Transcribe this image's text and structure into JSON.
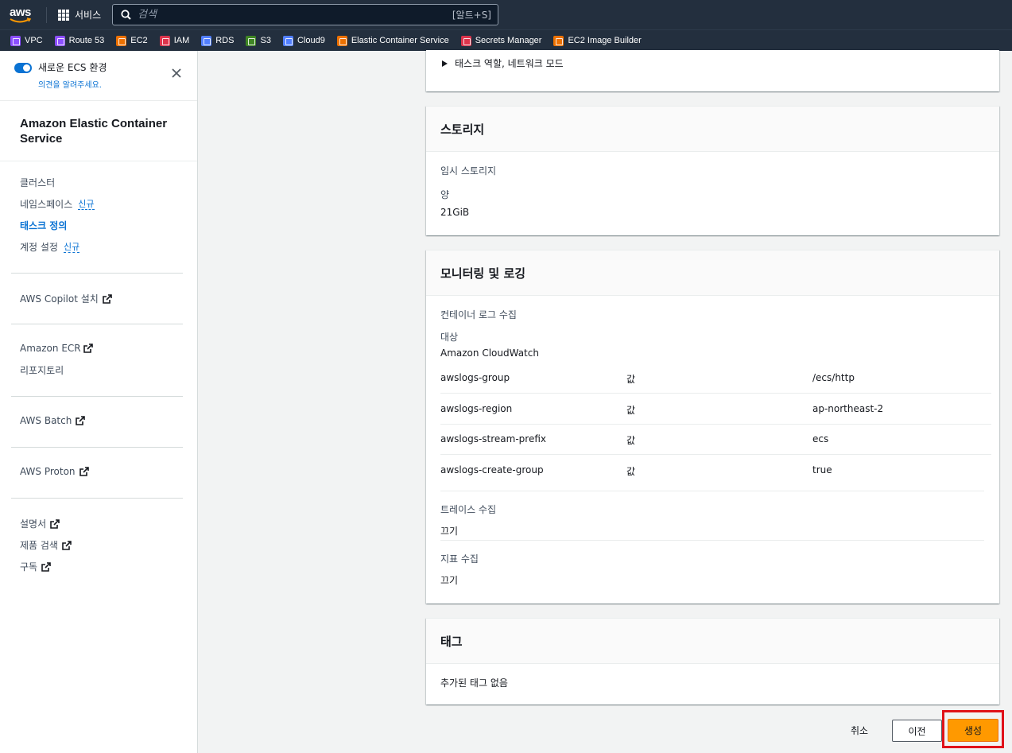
{
  "topnav": {
    "logo": "aws",
    "services_label": "서비스",
    "search_placeholder": "검색",
    "search_shortcut": "[알트+S]"
  },
  "favorites": [
    {
      "label": "VPC",
      "color": "#8c4fff"
    },
    {
      "label": "Route 53",
      "color": "#8c4fff"
    },
    {
      "label": "EC2",
      "color": "#ed7100"
    },
    {
      "label": "IAM",
      "color": "#dd344c"
    },
    {
      "label": "RDS",
      "color": "#527fff"
    },
    {
      "label": "S3",
      "color": "#3f8624"
    },
    {
      "label": "Cloud9",
      "color": "#527fff"
    },
    {
      "label": "Elastic Container Service",
      "color": "#ed7100"
    },
    {
      "label": "Secrets Manager",
      "color": "#dd344c"
    },
    {
      "label": "EC2 Image Builder",
      "color": "#ed7100"
    }
  ],
  "sidebar": {
    "toggle_title": "새로운 ECS 환경",
    "toggle_link": "의견을 알려주세요.",
    "service_title": "Amazon Elastic Container Service",
    "nav": {
      "clusters": "클러스터",
      "namespaces": "네임스페이스",
      "namespaces_badge": "신규",
      "task_definitions": "태스크 정의",
      "account_settings": "계정 설정",
      "account_badge": "신규",
      "copilot": "AWS Copilot 설치",
      "ecr": "Amazon ECR",
      "repositories": "리포지토리",
      "batch": "AWS Batch",
      "proton": "AWS Proton",
      "docs": "설명서",
      "product_search": "제품 검색",
      "subscribe": "구독"
    }
  },
  "main": {
    "task_role_expander": "태스크 역할, 네트워크 모드",
    "storage": {
      "title": "스토리지",
      "ephemeral_label": "임시 스토리지",
      "amount_label": "양",
      "amount_value": "21GiB"
    },
    "monitoring": {
      "title": "모니터링 및 로깅",
      "log_collection_label": "컨테이너 로그 수집",
      "target_label": "대상",
      "target_value": "Amazon CloudWatch",
      "options": [
        {
          "key": "awslogs-group",
          "type": "값",
          "value": "/ecs/http"
        },
        {
          "key": "awslogs-region",
          "type": "값",
          "value": "ap-northeast-2"
        },
        {
          "key": "awslogs-stream-prefix",
          "type": "값",
          "value": "ecs"
        },
        {
          "key": "awslogs-create-group",
          "type": "값",
          "value": "true"
        }
      ],
      "trace_label": "트레이스 수집",
      "trace_value": "끄기",
      "metric_label": "지표 수집",
      "metric_value": "끄기"
    },
    "tags": {
      "title": "태그",
      "empty": "추가된 태그 없음"
    }
  },
  "footer": {
    "cancel": "취소",
    "previous": "이전",
    "create": "생성"
  }
}
